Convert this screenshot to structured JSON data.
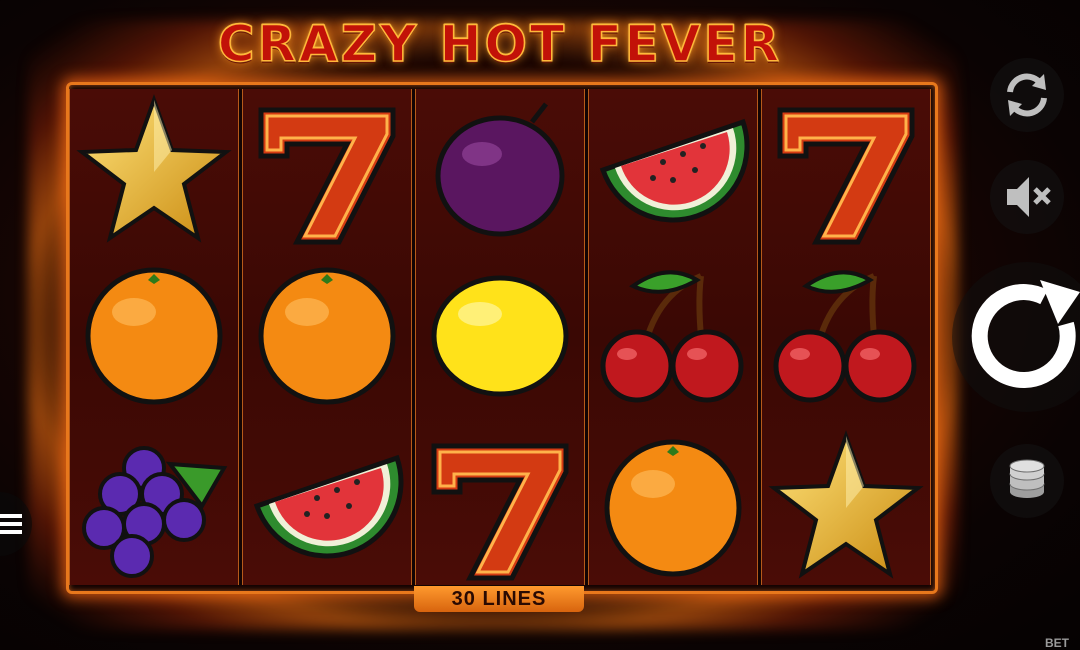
{
  "title": "CRAZY HOT FEVER",
  "lines_label": "30 LINES",
  "bet_label": "BET",
  "reels": [
    [
      "star-symbol",
      "orange-symbol",
      "grapes-symbol"
    ],
    [
      "seven-symbol",
      "orange-symbol",
      "watermelon-symbol"
    ],
    [
      "plum-symbol",
      "lemon-symbol",
      "seven-symbol"
    ],
    [
      "watermelon-symbol",
      "cherries-symbol",
      "orange-symbol"
    ],
    [
      "seven-symbol",
      "cherries-symbol",
      "star-symbol"
    ]
  ],
  "controls": {
    "autoplay_icon": "autoplay-icon",
    "sound_icon": "sound-muted-icon",
    "spin_icon": "spin-icon",
    "coins_icon": "coins-icon",
    "menu_icon": "menu-icon"
  },
  "colors": {
    "frame": "#e8781c",
    "title": "#c21208",
    "badge": "#ff9a2e"
  }
}
